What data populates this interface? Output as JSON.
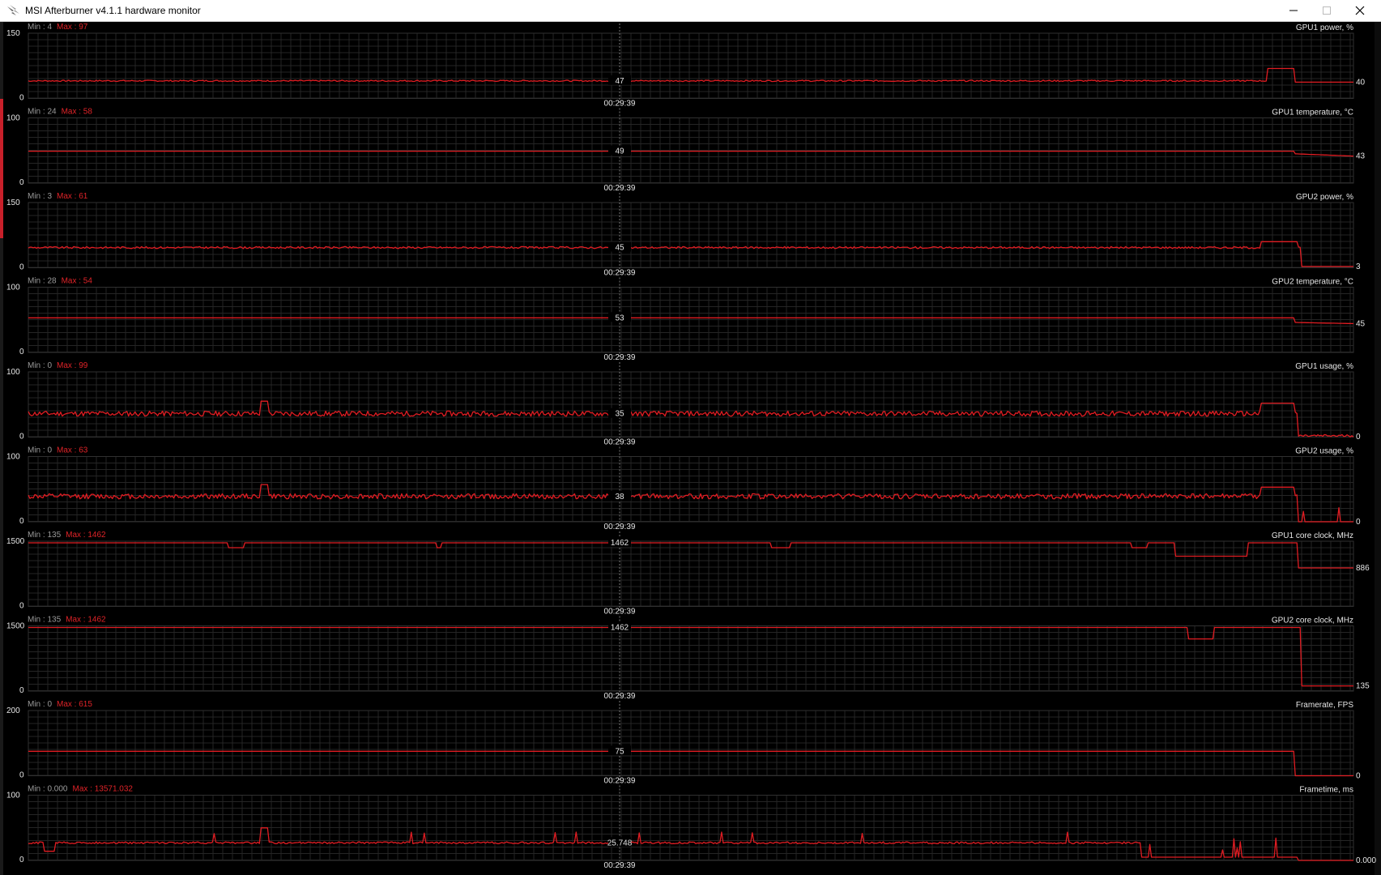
{
  "window": {
    "title": "MSI Afterburner v4.1.1 hardware monitor",
    "icon": "afterburner-flame-icon",
    "controls": [
      "minimize-icon",
      "maximize-icon",
      "close-icon"
    ]
  },
  "monitor": {
    "timestamp": "00:29:39",
    "colors": {
      "background": "#000000",
      "grid": "#252525",
      "series": "#e01c22",
      "max_label": "#e02328",
      "min_label": "#9a9a9a",
      "text": "#e6e6e6"
    },
    "graphs": [
      {
        "name": "GPU1 power, %",
        "min_text": "Min : 4",
        "max_text": "Max : 97",
        "y_top": "150",
        "y_bottom": "0",
        "ylim": [
          0,
          150
        ],
        "cursor_value": "47",
        "current_value": "40"
      },
      {
        "name": "GPU1 temperature, °C",
        "min_text": "Min : 24",
        "max_text": "Max : 58",
        "y_top": "100",
        "y_bottom": "0",
        "ylim": [
          0,
          100
        ],
        "cursor_value": "49",
        "current_value": "43"
      },
      {
        "name": "GPU2 power, %",
        "min_text": "Min : 3",
        "max_text": "Max : 61",
        "y_top": "150",
        "y_bottom": "0",
        "ylim": [
          0,
          150
        ],
        "cursor_value": "45",
        "current_value": "3"
      },
      {
        "name": "GPU2 temperature, °C",
        "min_text": "Min : 28",
        "max_text": "Max : 54",
        "y_top": "100",
        "y_bottom": "0",
        "ylim": [
          0,
          100
        ],
        "cursor_value": "53",
        "current_value": "45"
      },
      {
        "name": "GPU1 usage, %",
        "min_text": "Min : 0",
        "max_text": "Max : 99",
        "y_top": "100",
        "y_bottom": "0",
        "ylim": [
          0,
          100
        ],
        "cursor_value": "35",
        "current_value": "0"
      },
      {
        "name": "GPU2 usage, %",
        "min_text": "Min : 0",
        "max_text": "Max : 63",
        "y_top": "100",
        "y_bottom": "0",
        "ylim": [
          0,
          100
        ],
        "cursor_value": "38",
        "current_value": "0"
      },
      {
        "name": "GPU1 core clock, MHz",
        "min_text": "Min : 135",
        "max_text": "Max : 1462",
        "y_top": "1500",
        "y_bottom": "0",
        "ylim": [
          0,
          1500
        ],
        "cursor_value": "1462",
        "current_value": "886"
      },
      {
        "name": "GPU2 core clock, MHz",
        "min_text": "Min : 135",
        "max_text": "Max : 1462",
        "y_top": "1500",
        "y_bottom": "0",
        "ylim": [
          0,
          1500
        ],
        "cursor_value": "1462",
        "current_value": "135"
      },
      {
        "name": "Framerate, FPS",
        "min_text": "Min : 0",
        "max_text": "Max : 615",
        "y_top": "200",
        "y_bottom": "0",
        "ylim": [
          0,
          200
        ],
        "cursor_value": "75",
        "current_value": "0"
      },
      {
        "name": "Frametime, ms",
        "min_text": "Min : 0.000",
        "max_text": "Max : 13571.032",
        "y_top": "100",
        "y_bottom": "0",
        "ylim": [
          0,
          100
        ],
        "cursor_value": "25.748",
        "current_value": "0.000"
      }
    ]
  }
}
